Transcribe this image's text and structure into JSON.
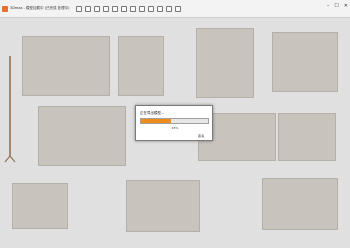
{
  "window": {
    "title": "3Dmax - 模型加载中 (已完成 处理中)",
    "controls": {
      "minimize": "–",
      "maximize": "☐",
      "close": "✕"
    }
  },
  "toolbar": {
    "icons": [
      "new-icon",
      "open-icon",
      "save-icon",
      "undo-icon",
      "redo-icon",
      "select-icon",
      "move-icon",
      "rotate-icon",
      "scale-icon",
      "render-icon",
      "material-icon",
      "camera-icon"
    ]
  },
  "dialog": {
    "title": "正在导出模型...",
    "progress": 0.45,
    "progress_text": "45%",
    "cancel_label": "取消"
  }
}
